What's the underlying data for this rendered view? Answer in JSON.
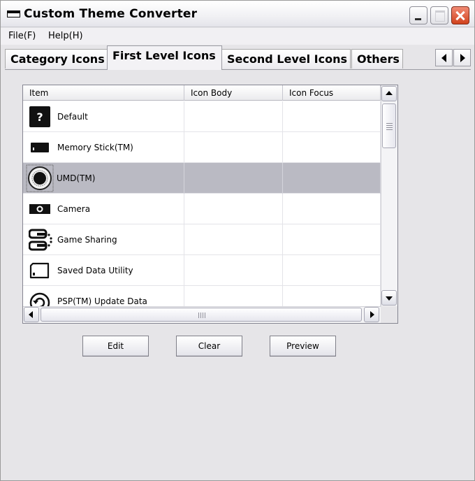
{
  "window": {
    "title": "Custom Theme Converter"
  },
  "menu": [
    {
      "label": "File(F)"
    },
    {
      "label": "Help(H)"
    }
  ],
  "tabs": [
    {
      "label": "Category Icons",
      "active": false
    },
    {
      "label": "First Level Icons",
      "active": true
    },
    {
      "label": "Second Level Icons",
      "active": false
    },
    {
      "label": "Others",
      "active": false
    }
  ],
  "list": {
    "columns": [
      "Item",
      "Icon Body",
      "Icon Focus"
    ],
    "rows": [
      {
        "label": "Default",
        "icon": "question-icon",
        "selected": false
      },
      {
        "label": "Memory Stick(TM)",
        "icon": "memory-stick-icon",
        "selected": false
      },
      {
        "label": "UMD(TM)",
        "icon": "umd-disc-icon",
        "selected": true
      },
      {
        "label": "Camera",
        "icon": "camera-icon",
        "selected": false
      },
      {
        "label": "Game Sharing",
        "icon": "game-sharing-icon",
        "selected": false
      },
      {
        "label": "Saved Data Utility",
        "icon": "saved-data-icon",
        "selected": false
      },
      {
        "label": "PSP(TM) Update Data",
        "icon": "update-icon",
        "selected": false
      }
    ]
  },
  "buttons": {
    "edit": "Edit",
    "clear": "Clear",
    "preview": "Preview"
  },
  "colors": {
    "selection": "#babac3",
    "face": "#e6e5e8",
    "close_button": "#d1421d"
  }
}
